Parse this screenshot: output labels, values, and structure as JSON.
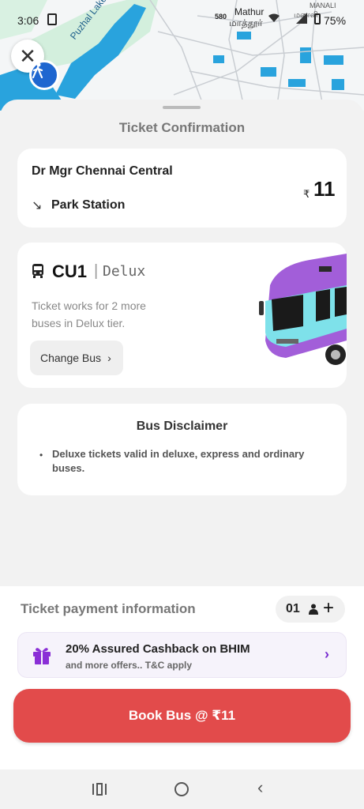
{
  "status_bar": {
    "time": "3:06",
    "map_label_1": "Mathur",
    "map_label_2": "மாத்தூர்",
    "map_label_3": "MANALI",
    "map_label_4": "மணலி",
    "road_number": "580",
    "battery": "75%"
  },
  "map": {
    "lake_label": "Puzhal Lake"
  },
  "sheet": {
    "title": "Ticket Confirmation",
    "route": {
      "from": "Dr  Mgr Chennai Central",
      "to": "Park Station",
      "currency_symbol": "₹",
      "price": "11"
    },
    "bus": {
      "code": "CU1",
      "separator": "|",
      "tier": "Delux",
      "description": "Ticket works for 2 more buses in Delux tier.",
      "change_label": "Change Bus",
      "change_chevron": "›"
    },
    "disclaimer": {
      "title": "Bus Disclaimer",
      "bullet": "•",
      "text": "Deluxe tickets valid in deluxe, express and ordinary buses."
    }
  },
  "payment": {
    "title": "Ticket payment information",
    "quantity": "01",
    "plus": "+",
    "offer": {
      "title": "20% Assured Cashback on BHIM",
      "subtitle": "and more offers.. T&C apply",
      "chevron": "›"
    },
    "book_label": "Book Bus @ ₹11"
  },
  "navbar": {
    "back": "‹"
  },
  "colors": {
    "primary_button": "#e24b4b",
    "offer_accent": "#7a2fd0",
    "map_water": "#29a3dd",
    "map_green": "#cfeedd"
  }
}
